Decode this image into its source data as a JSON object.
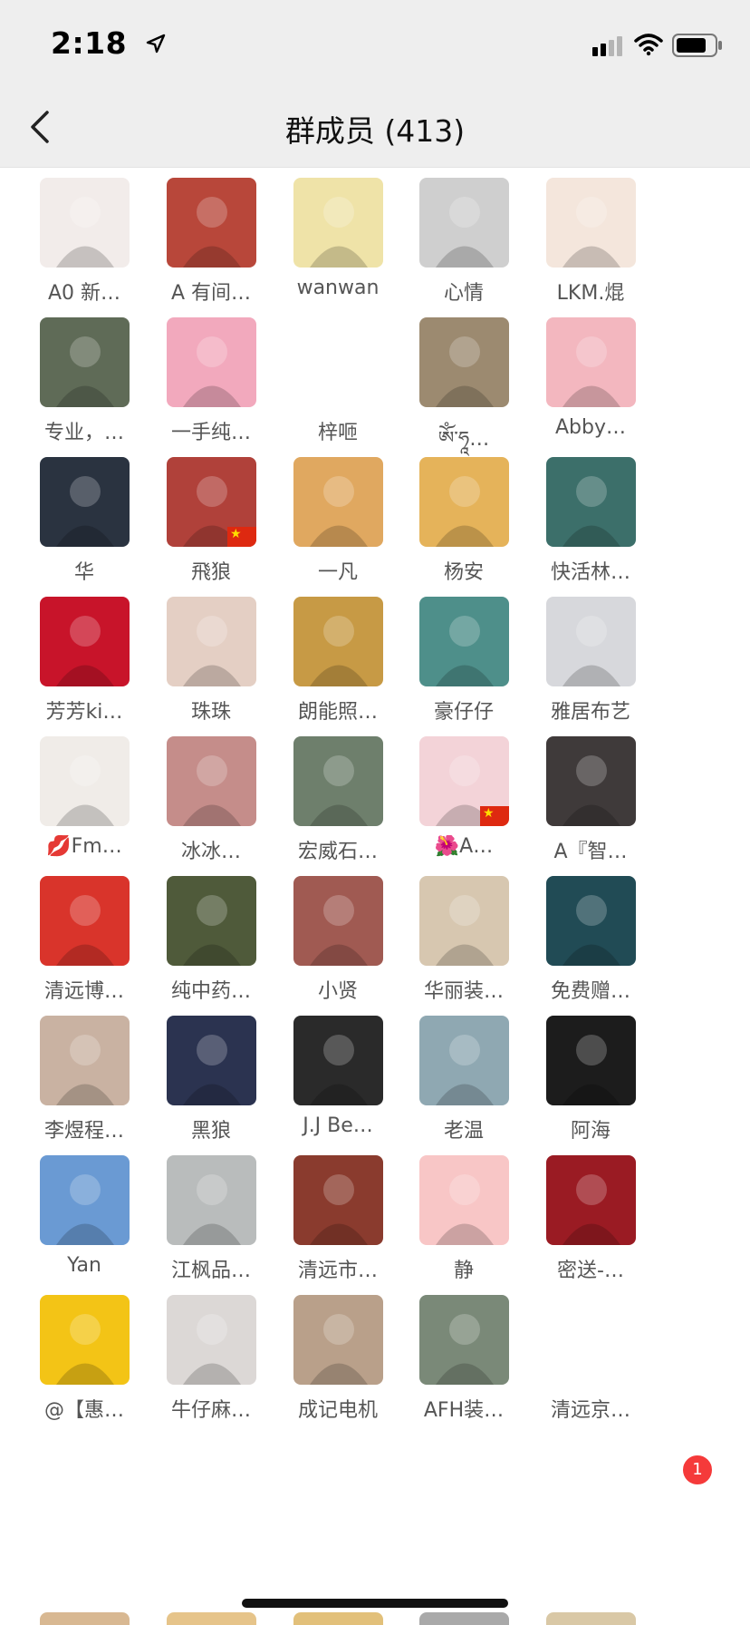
{
  "status_bar": {
    "time": "2:18",
    "icons": [
      "location-arrow-icon",
      "cellular-signal-icon",
      "wifi-icon",
      "battery-icon"
    ]
  },
  "nav": {
    "back_icon": "chevron-left-icon",
    "title": "群成员 (413)"
  },
  "members": [
    {
      "name": "A0 新…",
      "avatar_color": "#f2ecea"
    },
    {
      "name": "A 有间…",
      "avatar_color": "#b8473a"
    },
    {
      "name": "wanwan",
      "avatar_color": "#efe3a8"
    },
    {
      "name": "心情",
      "avatar_color": "#cfcfcf"
    },
    {
      "name": "LKM.焜",
      "avatar_color": "#f4e6dc"
    },
    {
      "name": "专业，…",
      "avatar_color": "#5f6b57"
    },
    {
      "name": "一手纯…",
      "avatar_color": "#f2a9bd"
    },
    {
      "name": "梓咂",
      "avatar_color": "#ffffff"
    },
    {
      "name": "ༀ་ཧཱ…",
      "avatar_color": "#9c8a70"
    },
    {
      "name": "Abby…",
      "avatar_color": "#f3b7bf"
    },
    {
      "name": "华",
      "avatar_color": "#2a3340"
    },
    {
      "name": "飛狼",
      "avatar_color": "#b0413a"
    },
    {
      "name": "一凡",
      "avatar_color": "#e0a860"
    },
    {
      "name": "杨安",
      "avatar_color": "#e5b35a"
    },
    {
      "name": "快活林…",
      "avatar_color": "#3c6f6a"
    },
    {
      "name": "芳芳ki…",
      "avatar_color": "#c8142a"
    },
    {
      "name": "珠珠",
      "avatar_color": "#e4cfc4"
    },
    {
      "name": "朗能照…",
      "avatar_color": "#c79a45"
    },
    {
      "name": "豪仔仔",
      "avatar_color": "#4e8f8a"
    },
    {
      "name": "雅居布艺",
      "avatar_color": "#d7d8dc"
    },
    {
      "name": "💋Fm…",
      "avatar_color": "#f0ece8"
    },
    {
      "name": "冰冰…",
      "avatar_color": "#c58d8a"
    },
    {
      "name": "宏威石…",
      "avatar_color": "#6e7f6c"
    },
    {
      "name": "🌺A…",
      "avatar_color": "#f3d3d8"
    },
    {
      "name": "A『智…",
      "avatar_color": "#3f3a3a"
    },
    {
      "name": "清远博…",
      "avatar_color": "#d9342b"
    },
    {
      "name": "纯中药…",
      "avatar_color": "#4f5a3a"
    },
    {
      "name": "小贤",
      "avatar_color": "#a05a52"
    },
    {
      "name": "华丽装…",
      "avatar_color": "#d7c7b0"
    },
    {
      "name": "免费赠…",
      "avatar_color": "#214b55"
    },
    {
      "name": "李煜程…",
      "avatar_color": "#c9b2a2"
    },
    {
      "name": "黑狼",
      "avatar_color": "#2b3350"
    },
    {
      "name": "J.J Be…",
      "avatar_color": "#2a2a2a"
    },
    {
      "name": "老温",
      "avatar_color": "#8fa8b2"
    },
    {
      "name": "阿海",
      "avatar_color": "#1c1c1c"
    },
    {
      "name": "Yan",
      "avatar_color": "#6a9ad3"
    },
    {
      "name": "江枫品…",
      "avatar_color": "#b9bcbc"
    },
    {
      "name": "清远市…",
      "avatar_color": "#8a3b2e"
    },
    {
      "name": "静",
      "avatar_color": "#f8c6c6"
    },
    {
      "name": "密送-…",
      "avatar_color": "#9a1b23"
    },
    {
      "name": "@【惠…",
      "avatar_color": "#f3c416"
    },
    {
      "name": "牛仔麻…",
      "avatar_color": "#dcd8d6"
    },
    {
      "name": "成记电机",
      "avatar_color": "#b9a08a"
    },
    {
      "name": "AFH装…",
      "avatar_color": "#7a8978"
    },
    {
      "name": "清远京…",
      "avatar_color": "#ffffff"
    }
  ],
  "notification_badge": "1",
  "colors": {
    "header_bg": "#eeeeee",
    "name_text": "#555555",
    "badge": "#f53a3a",
    "flag_red": "#de2910"
  }
}
